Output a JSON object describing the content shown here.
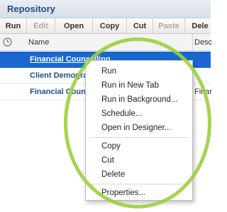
{
  "window": {
    "title": "Repository"
  },
  "toolbar": {
    "buttons": [
      {
        "label": "Run",
        "enabled": true
      },
      {
        "label": "Edit",
        "enabled": false
      },
      {
        "label": "Open",
        "enabled": true
      },
      {
        "label": "Copy",
        "enabled": true
      },
      {
        "label": "Cut",
        "enabled": true
      },
      {
        "label": "Paste",
        "enabled": false
      },
      {
        "label": "Dele",
        "enabled": true
      }
    ]
  },
  "columns": {
    "name": "Name",
    "description": "Desc",
    "status_icon": "clock-icon"
  },
  "rows": [
    {
      "name": "Financial Counselling",
      "description": "",
      "selected": true
    },
    {
      "name": "Client Demogra",
      "description": "",
      "selected": false
    },
    {
      "name": "Financial Coun",
      "description": "Finar",
      "selected": false
    }
  ],
  "context_menu": {
    "items": [
      "Run",
      "Run in New Tab",
      "Run in Background...",
      "Schedule...",
      "Open in Designer...",
      "Copy",
      "Cut",
      "Delete",
      "Properties..."
    ]
  },
  "colors": {
    "selection": "#1a68cf",
    "title_text": "#1f4f86",
    "highlight_ellipse": "#9ccf3b"
  }
}
